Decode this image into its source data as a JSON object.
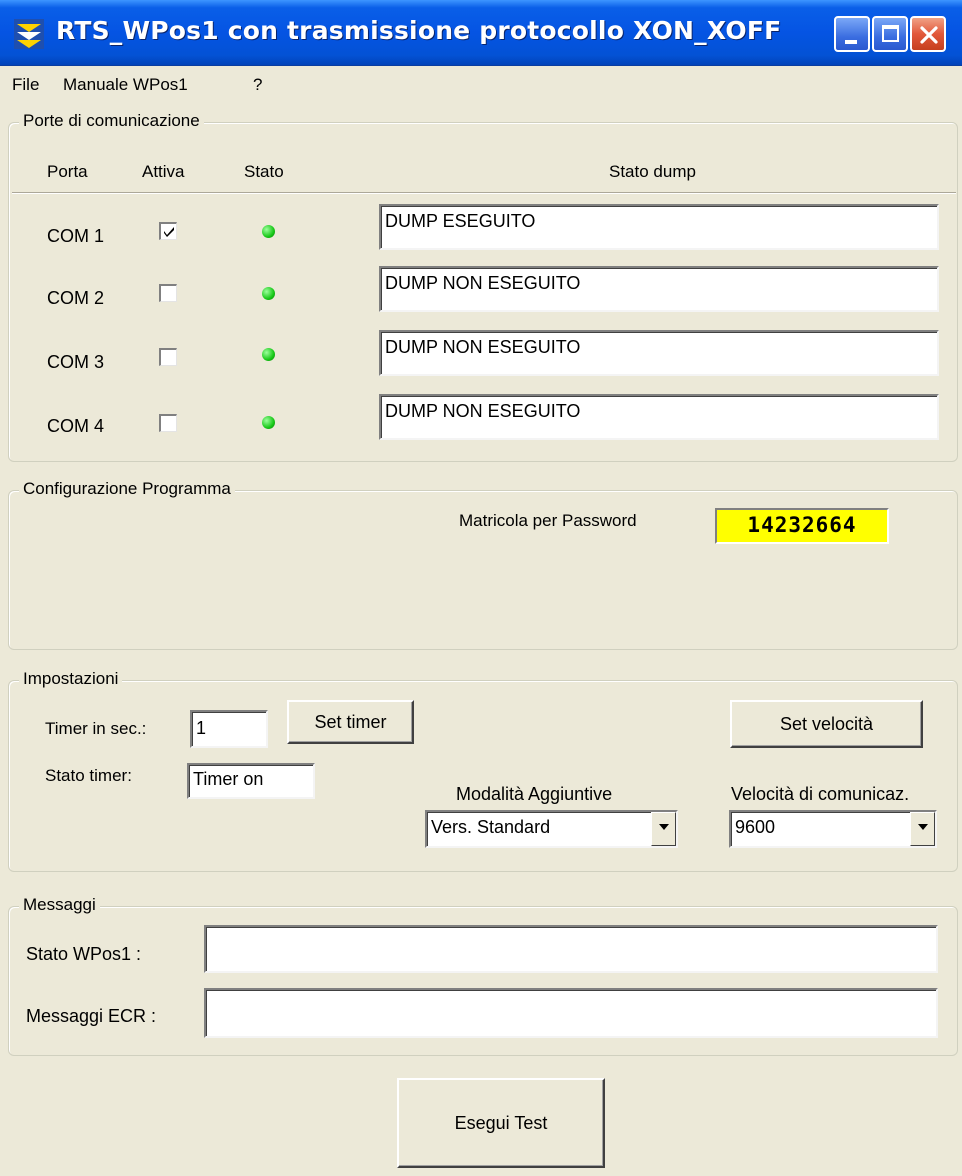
{
  "window": {
    "title": "RTS_WPos1 con trasmissione protocollo XON_XOFF"
  },
  "menu": {
    "file": "File",
    "manuale": "Manuale WPos1",
    "help": "?"
  },
  "ports_group": {
    "title": "Porte di comunicazione",
    "headers": {
      "porta": "Porta",
      "attiva": "Attiva",
      "stato": "Stato",
      "stato_dump": "Stato dump"
    },
    "rows": [
      {
        "port": "COM 1",
        "active": true,
        "status_color": "#18C818",
        "dump": "DUMP ESEGUITO"
      },
      {
        "port": "COM 2",
        "active": false,
        "status_color": "#18C818",
        "dump": "DUMP NON ESEGUITO"
      },
      {
        "port": "COM 3",
        "active": false,
        "status_color": "#18C818",
        "dump": "DUMP NON ESEGUITO"
      },
      {
        "port": "COM 4",
        "active": false,
        "status_color": "#18C818",
        "dump": "DUMP NON ESEGUITO"
      }
    ]
  },
  "config_group": {
    "title": "Configurazione Programma",
    "matricola_label": "Matricola per Password",
    "matricola_value": "14232664",
    "matricola_bg": "#FFFF00"
  },
  "settings_group": {
    "title": "Impostazioni",
    "timer_label": "Timer in sec.:",
    "timer_value": "1",
    "set_timer_button": "Set timer",
    "set_speed_button": "Set velocità",
    "timer_state_label": "Stato timer:",
    "timer_state_value": "Timer on",
    "modes_label": "Modalità Aggiuntive",
    "modes_selected": "Vers. Standard",
    "speed_label": "Velocità di comunicaz.",
    "speed_selected": "9600"
  },
  "messages_group": {
    "title": "Messaggi",
    "wpos_label": "Stato  WPos1 :",
    "wpos_value": "",
    "ecr_label": "Messaggi ECR :",
    "ecr_value": ""
  },
  "run_test_button": "Esegui Test",
  "icons": {
    "app": "rts-app-icon",
    "minimize": "minimize-icon",
    "maximize": "maximize-icon",
    "close": "close-icon",
    "check": "checkmark-icon",
    "dropdown": "dropdown-arrow-icon"
  }
}
